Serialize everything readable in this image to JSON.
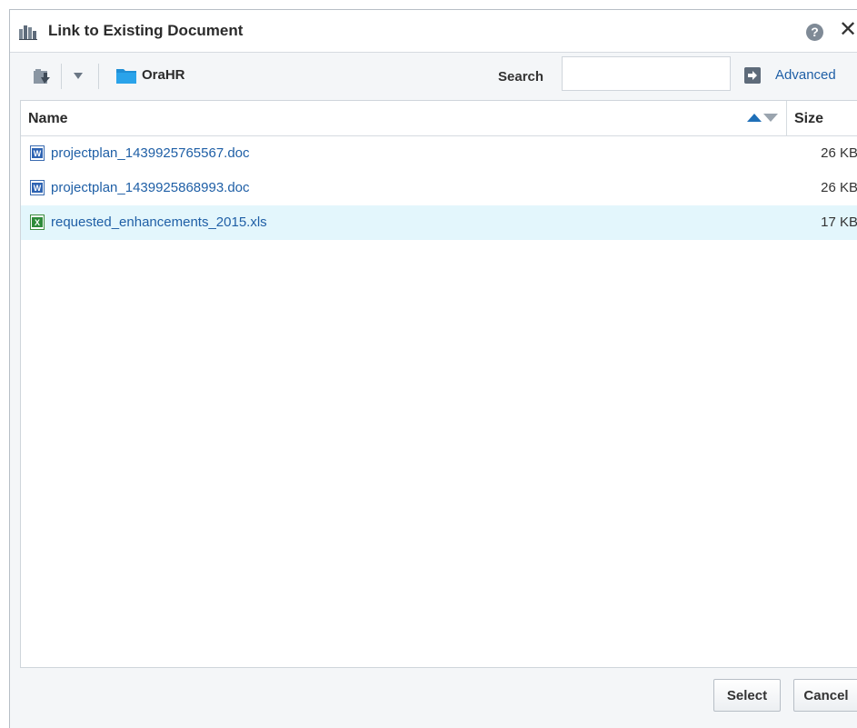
{
  "dialog": {
    "title": "Link to Existing Document",
    "help_icon": "?",
    "close_icon": "✕"
  },
  "toolbar": {
    "folder_name": "OraHR",
    "search_label": "Search",
    "search_value": "",
    "advanced_label": "Advanced"
  },
  "table": {
    "columns": {
      "name": "Name",
      "size": "Size"
    },
    "sort": "name ascending",
    "rows": [
      {
        "name": "projectplan_1439925765567.doc",
        "size": "26 KB",
        "type": "word-doc-icon",
        "selected": false
      },
      {
        "name": "projectplan_1439925868993.doc",
        "size": "26 KB",
        "type": "word-doc-icon",
        "selected": false
      },
      {
        "name": "requested_enhancements_2015.xls",
        "size": "17 KB",
        "type": "excel-xls-icon",
        "selected": true
      }
    ]
  },
  "footer": {
    "select_label": "Select",
    "cancel_label": "Cancel"
  },
  "colors": {
    "link": "#1f5fa6",
    "selected_row": "#e3f6fc",
    "sort_active": "#1f6fb8",
    "dialog_bg": "#f4f6f8"
  }
}
